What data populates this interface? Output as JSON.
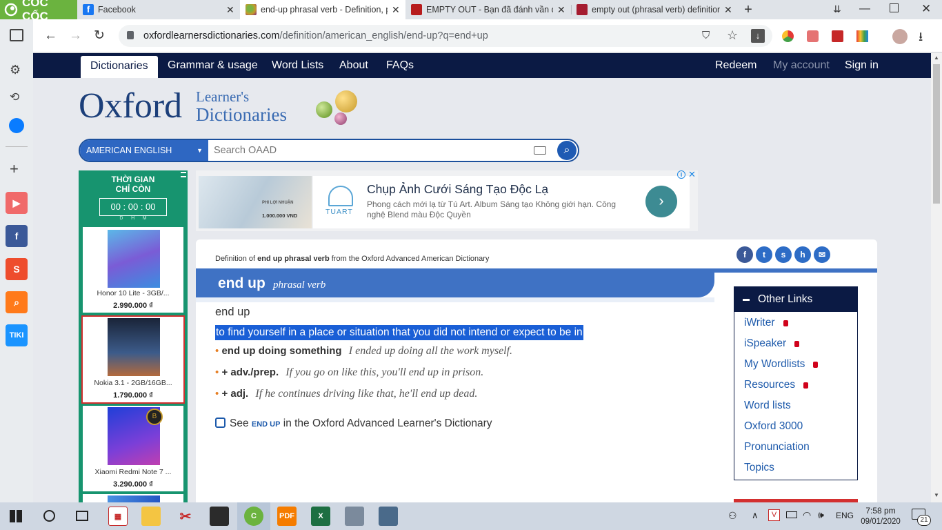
{
  "browser": {
    "brand": "CỐC CỐC",
    "tabs": [
      {
        "title": "Facebook",
        "favicon_color": "#1877f2"
      },
      {
        "title": "end-up phrasal verb - Definition, p",
        "favicon_color": "#c79a2b"
      },
      {
        "title": "EMPTY OUT - Bạn đã đánh vần đú",
        "favicon_color": "#b71c1c"
      },
      {
        "title": "empty out (phrasal verb) definition",
        "favicon_color": "#a51c30"
      }
    ],
    "new_tab": "+",
    "url_host": "oxfordlearnersdictionaries.com",
    "url_path": "/definition/american_english/end-up?q=end+up"
  },
  "site": {
    "nav": [
      "Dictionaries",
      "Grammar & usage",
      "Word Lists",
      "About",
      "FAQs"
    ],
    "nav_right": [
      "Redeem",
      "My account",
      "Sign in"
    ],
    "logo_main": "Oxford",
    "logo_sub1": "Learner's",
    "logo_sub2": "Dictionaries",
    "search_lang": "AMERICAN ENGLISH",
    "search_placeholder": "Search OAAD"
  },
  "ad_left": {
    "title1": "THỜI GIAN",
    "title2": "CHỈ CÒN",
    "timer": "00 : 00 : 00",
    "timer_units": "D      H      M",
    "products": [
      {
        "name": "Honor 10 Lite - 3GB/...",
        "price": "2.990.000 ₫"
      },
      {
        "name": "Nokia 3.1 - 2GB/16GB...",
        "price": "1.790.000 ₫"
      },
      {
        "name": "Xiaomi Redmi Note 7 ...",
        "price": "3.290.000 ₫"
      }
    ]
  },
  "ad_banner": {
    "title": "Chụp Ảnh Cưới Sáng Tạo Độc Lạ",
    "desc": "Phong cách mới lạ từ Tú Art. Album Sáng tạo Không giới hạn. Công nghệ Blend màu Độc Quyền",
    "brand": "TUART",
    "promo_line1": "PHI LỢI NHUẬN",
    "promo_line2": "1.000.000 VND"
  },
  "entry": {
    "source_prefix": "Definition of ",
    "source_term": "end up phrasal verb",
    "source_suffix": " from the Oxford Advanced American Dictionary",
    "headword": "end up",
    "pos": "phrasal verb",
    "phrase": "end up",
    "definition": "to find yourself in a place or situation that you did not intend or expect to be in",
    "examples": [
      {
        "pattern": "end up doing something",
        "text": "I ended up doing all the work myself."
      },
      {
        "pattern": "+ adv./prep.",
        "text": "If you go on like this, you'll end up in prison."
      },
      {
        "pattern": "+ adj.",
        "text": "If he continues driving like that, he'll end up dead."
      }
    ],
    "see_prefix": "See ",
    "see_term": "END UP",
    "see_suffix": " in the Oxford Advanced Learner's Dictionary"
  },
  "other_links": {
    "title": "Other Links",
    "items": [
      {
        "label": "iWriter",
        "locked": true
      },
      {
        "label": "iSpeaker",
        "locked": true
      },
      {
        "label": "My Wordlists",
        "locked": true
      },
      {
        "label": "Resources",
        "locked": true
      },
      {
        "label": "Word lists",
        "locked": false
      },
      {
        "label": "Oxford 3000",
        "locked": false
      },
      {
        "label": "Pronunciation",
        "locked": false
      },
      {
        "label": "Topics",
        "locked": false
      }
    ]
  },
  "taskbar": {
    "lang": "ENG",
    "time": "7:58 pm",
    "date": "09/01/2020",
    "notif_count": "21"
  },
  "colors": {
    "navbar": "#0b1a44",
    "accent_blue": "#3f72c4",
    "ad_green": "#17946f",
    "selection": "#1a5fd6"
  }
}
